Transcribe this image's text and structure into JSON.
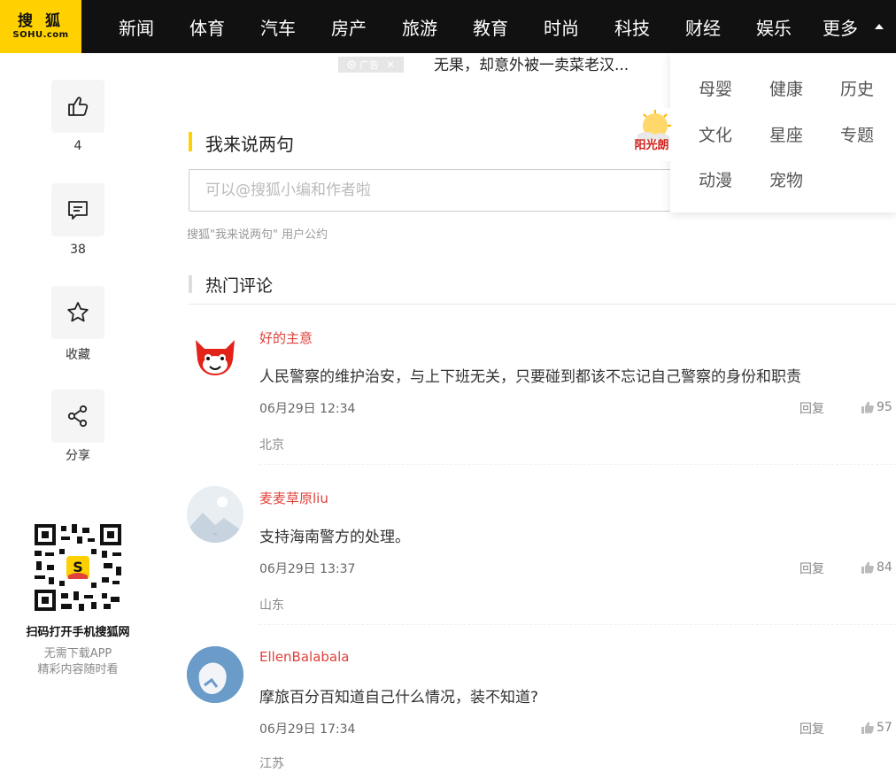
{
  "header": {
    "logo_cn": "搜 狐",
    "logo_en": "SOHU.com",
    "nav": [
      "新闻",
      "体育",
      "汽车",
      "房产",
      "旅游",
      "教育",
      "时尚",
      "科技",
      "财经",
      "娱乐",
      "更多"
    ]
  },
  "ad": {
    "tag": "广告",
    "close": "✕",
    "title": "无果，却意外被一卖菜老汉..."
  },
  "more_menu": {
    "items": [
      "母婴",
      "健康",
      "历史",
      "文化",
      "星座",
      "专题",
      "动漫",
      "宠物"
    ]
  },
  "promo": {
    "thumb_text": "阳光朗"
  },
  "rail": {
    "like_count": "4",
    "comment_count": "38",
    "favorite_label": "收藏",
    "share_label": "分享"
  },
  "qr": {
    "caption": "扫码打开手机搜狐网",
    "line1": "无需下载APP",
    "line2": "精彩内容随时看"
  },
  "composer": {
    "title": "我来说两句",
    "placeholder": "可以@搜狐小编和作者啦",
    "agreement": "搜狐\"我来说两句\" 用户公约"
  },
  "hot": {
    "title": "热门评论",
    "reply_label": "回复",
    "comments": [
      {
        "user": "好的主意",
        "text": "人民警察的维护治安，与上下班无关，只要碰到都该不忘记自己警察的身份和职责",
        "time": "06月29日 12:34",
        "location": "北京",
        "likes": "95"
      },
      {
        "user": "麦麦草原liu",
        "text": "支持海南警方的处理。",
        "time": "06月29日 13:37",
        "location": "山东",
        "likes": "84"
      },
      {
        "user": "EllenBalabala",
        "text": "摩旅百分百知道自己什么情况，装不知道?",
        "time": "06月29日 17:34",
        "location": "江苏",
        "likes": "57"
      }
    ]
  },
  "colors": {
    "brand_yellow": "#ffd100",
    "username_red": "#e0413b",
    "topbar": "#111111"
  }
}
